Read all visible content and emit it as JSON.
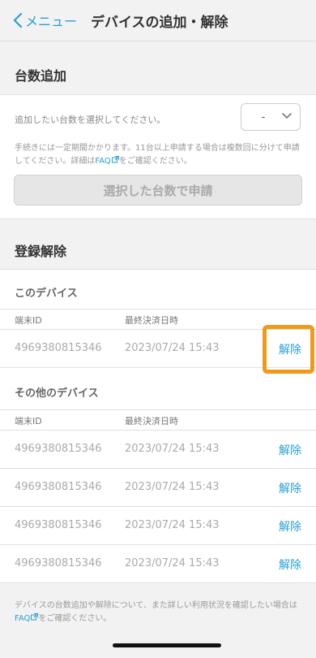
{
  "nav": {
    "back_label": "メニュー",
    "title": "デバイスの追加・解除"
  },
  "add": {
    "section_title": "台数追加",
    "prompt": "追加したい台数を選択してください。",
    "select_value": "-",
    "note_prefix": "手続きには一定期間かかります。11台以上申請する場合は複数回に分けて申請してください。詳細は",
    "note_link": "FAQ",
    "note_suffix": "をご確認ください。",
    "apply_label": "選択した台数で申請"
  },
  "remove": {
    "section_title": "登録解除",
    "this_device_title": "このデバイス",
    "other_devices_title": "その他のデバイス",
    "col_id": "端末ID",
    "col_date": "最終決済日時",
    "this_device": {
      "id": "4969380815346",
      "date": "2023/07/24 15:43",
      "action": "解除"
    },
    "others": [
      {
        "id": "4969380815346",
        "date": "2023/07/24 15:43",
        "action": "解除"
      },
      {
        "id": "4969380815346",
        "date": "2023/07/24 15:43",
        "action": "解除"
      },
      {
        "id": "4969380815346",
        "date": "2023/07/24 15:43",
        "action": "解除"
      },
      {
        "id": "4969380815346",
        "date": "2023/07/24 15:43",
        "action": "解除"
      }
    ]
  },
  "footer": {
    "prefix": "デバイスの台数追加や解除について、また詳しい利用状況を確認したい場合は",
    "link": "FAQ",
    "suffix": "をご確認ください。"
  },
  "colors": {
    "accent": "#2a9fd6",
    "highlight": "#f19a1a"
  }
}
